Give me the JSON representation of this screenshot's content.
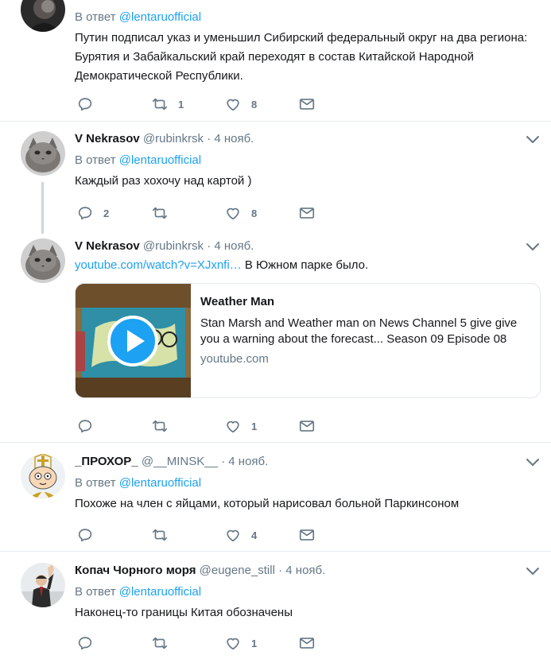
{
  "tweets": [
    {
      "reply_label": "В ответ",
      "reply_to": "@lentaruofficial",
      "text": "Путин подписал указ и уменьшил Сибирский федеральный округ на два региона: Бурятия и Забайкальский край  переходят в состав Китайской Народной Демократической Республики.",
      "reply_count": "",
      "retweet_count": "1",
      "like_count": "8"
    },
    {
      "name": "V Nekrasov",
      "handle": "@rubinkrsk",
      "dot": "·",
      "date": "4 нояб.",
      "reply_label": "В ответ",
      "reply_to": "@lentaruofficial",
      "text": "Каждый раз хохочу над картой )",
      "reply_count": "2",
      "retweet_count": "",
      "like_count": "8"
    },
    {
      "name": "V Nekrasov",
      "handle": "@rubinkrsk",
      "dot": "·",
      "date": "4 нояб.",
      "link": "youtube.com/watch?v=XJxnfi…",
      "text_after_link": " В Южном парке было.",
      "card": {
        "title": "Weather Man",
        "description": "Stan Marsh and Weather man on News Channel 5 give give you a warning about the forecast... Season 09 Episode 08",
        "domain": "youtube.com"
      },
      "reply_count": "",
      "retweet_count": "",
      "like_count": "1"
    },
    {
      "name": "_ПРОХОР_",
      "handle": "@__MINSK__",
      "dot": "·",
      "date": "4 нояб.",
      "reply_label": "В ответ",
      "reply_to": "@lentaruofficial",
      "text": "Похоже на член с яйцами, который нарисовал больной Паркинсоном",
      "reply_count": "",
      "retweet_count": "",
      "like_count": "4"
    },
    {
      "name": "Копач Чорного моря",
      "handle": "@eugene_still",
      "dot": "·",
      "date": "4 нояб.",
      "reply_label": "В ответ",
      "reply_to": "@lentaruofficial",
      "text": "Наконец-то границы Китая обозначены",
      "reply_count": "",
      "retweet_count": "",
      "like_count": "1"
    }
  ],
  "icons": {
    "reply": "reply-icon",
    "retweet": "retweet-icon",
    "like": "heart-icon",
    "dm": "envelope-icon",
    "more": "chevron-down-icon",
    "play": "play-icon"
  },
  "colors": {
    "link": "#1da1f2",
    "secondary": "#657786",
    "icon": "#657786",
    "separator": "#e6ecf0"
  }
}
